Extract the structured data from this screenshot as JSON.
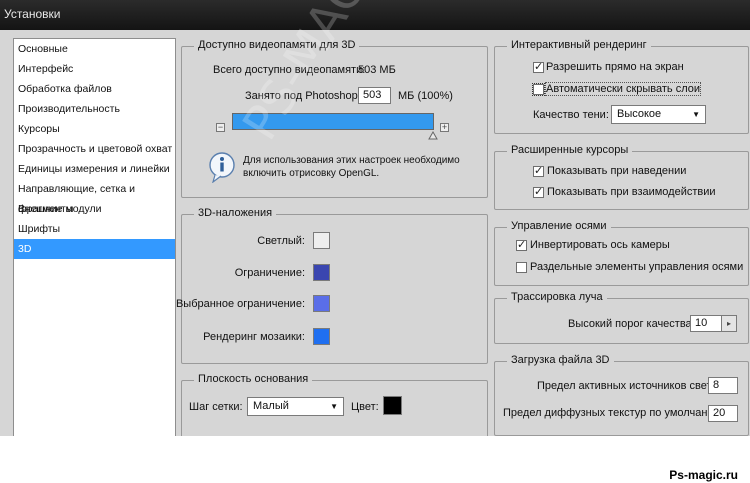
{
  "window": {
    "title": "Установки"
  },
  "nav": {
    "items": [
      {
        "label": "Основные"
      },
      {
        "label": "Интерфейс"
      },
      {
        "label": "Обработка файлов"
      },
      {
        "label": "Производительность"
      },
      {
        "label": "Курсоры"
      },
      {
        "label": "Прозрачность и цветовой охват"
      },
      {
        "label": "Единицы измерения и линейки"
      },
      {
        "label": "Направляющие, сетка и фрагменты"
      },
      {
        "label": "Внешние модули"
      },
      {
        "label": "Шрифты"
      },
      {
        "label": "3D"
      }
    ],
    "selected_index": 10
  },
  "vram": {
    "legend": "Доступно видеопамяти для 3D",
    "total_label": "Всего доступно видеопамяти:",
    "total_value": "503 МБ",
    "used_label": "Занято под Photoshop:",
    "used_value": "503",
    "used_unit": "МБ (100%)",
    "usage_percent": 100,
    "minus": "−",
    "plus": "+",
    "info_text_line1": "Для использования этих настроек необходимо",
    "info_text_line2": "включить отрисовку OpenGL."
  },
  "overlays": {
    "legend": "3D-наложения",
    "rows": [
      {
        "label": "Светлый:",
        "color": "#eeeeee"
      },
      {
        "label": "Ограничение:",
        "color": "#3a46b0"
      },
      {
        "label": "Выбранное ограничение:",
        "color": "#5a6ee8"
      },
      {
        "label": "Рендеринг мозаики:",
        "color": "#1f6ff0"
      }
    ]
  },
  "ground": {
    "legend": "Плоскость основания",
    "grid_label": "Шаг сетки:",
    "grid_value": "Малый",
    "color_label": "Цвет:",
    "color": "#000000"
  },
  "interactive": {
    "legend": "Интерактивный рендеринг",
    "allow_direct": {
      "label": "Разрешить прямо на экран",
      "checked": true
    },
    "auto_hide": {
      "label": "Автоматически скрывать слои",
      "checked": false
    },
    "shadow_label": "Качество тени:",
    "shadow_value": "Высокое"
  },
  "cursors": {
    "legend": "Расширенные курсоры",
    "hover": {
      "label": "Показывать при наведении",
      "checked": true
    },
    "interact": {
      "label": "Показывать при взаимодействии",
      "checked": true
    }
  },
  "axes": {
    "legend": "Управление осями",
    "invert": {
      "label": "Инвертировать ось камеры",
      "checked": true
    },
    "separate": {
      "label": "Раздельные элементы управления осями",
      "checked": false
    }
  },
  "raytrace": {
    "legend": "Трассировка луча",
    "quality_label": "Высокий порог качества:",
    "quality_value": "10"
  },
  "fileload": {
    "legend": "Загрузка файла 3D",
    "lights_label": "Предел активных источников света:",
    "lights_value": "8",
    "textures_label": "Предел диффузных текстур по умолчанию:",
    "textures_value": "20"
  },
  "watermark": "PS-MAGIC.RU",
  "footer": "Ps-magic.ru",
  "colors": {
    "selection": "#3399ff",
    "dialog_bg": "#d6d6d6",
    "bar_fill": "#3399ee"
  }
}
